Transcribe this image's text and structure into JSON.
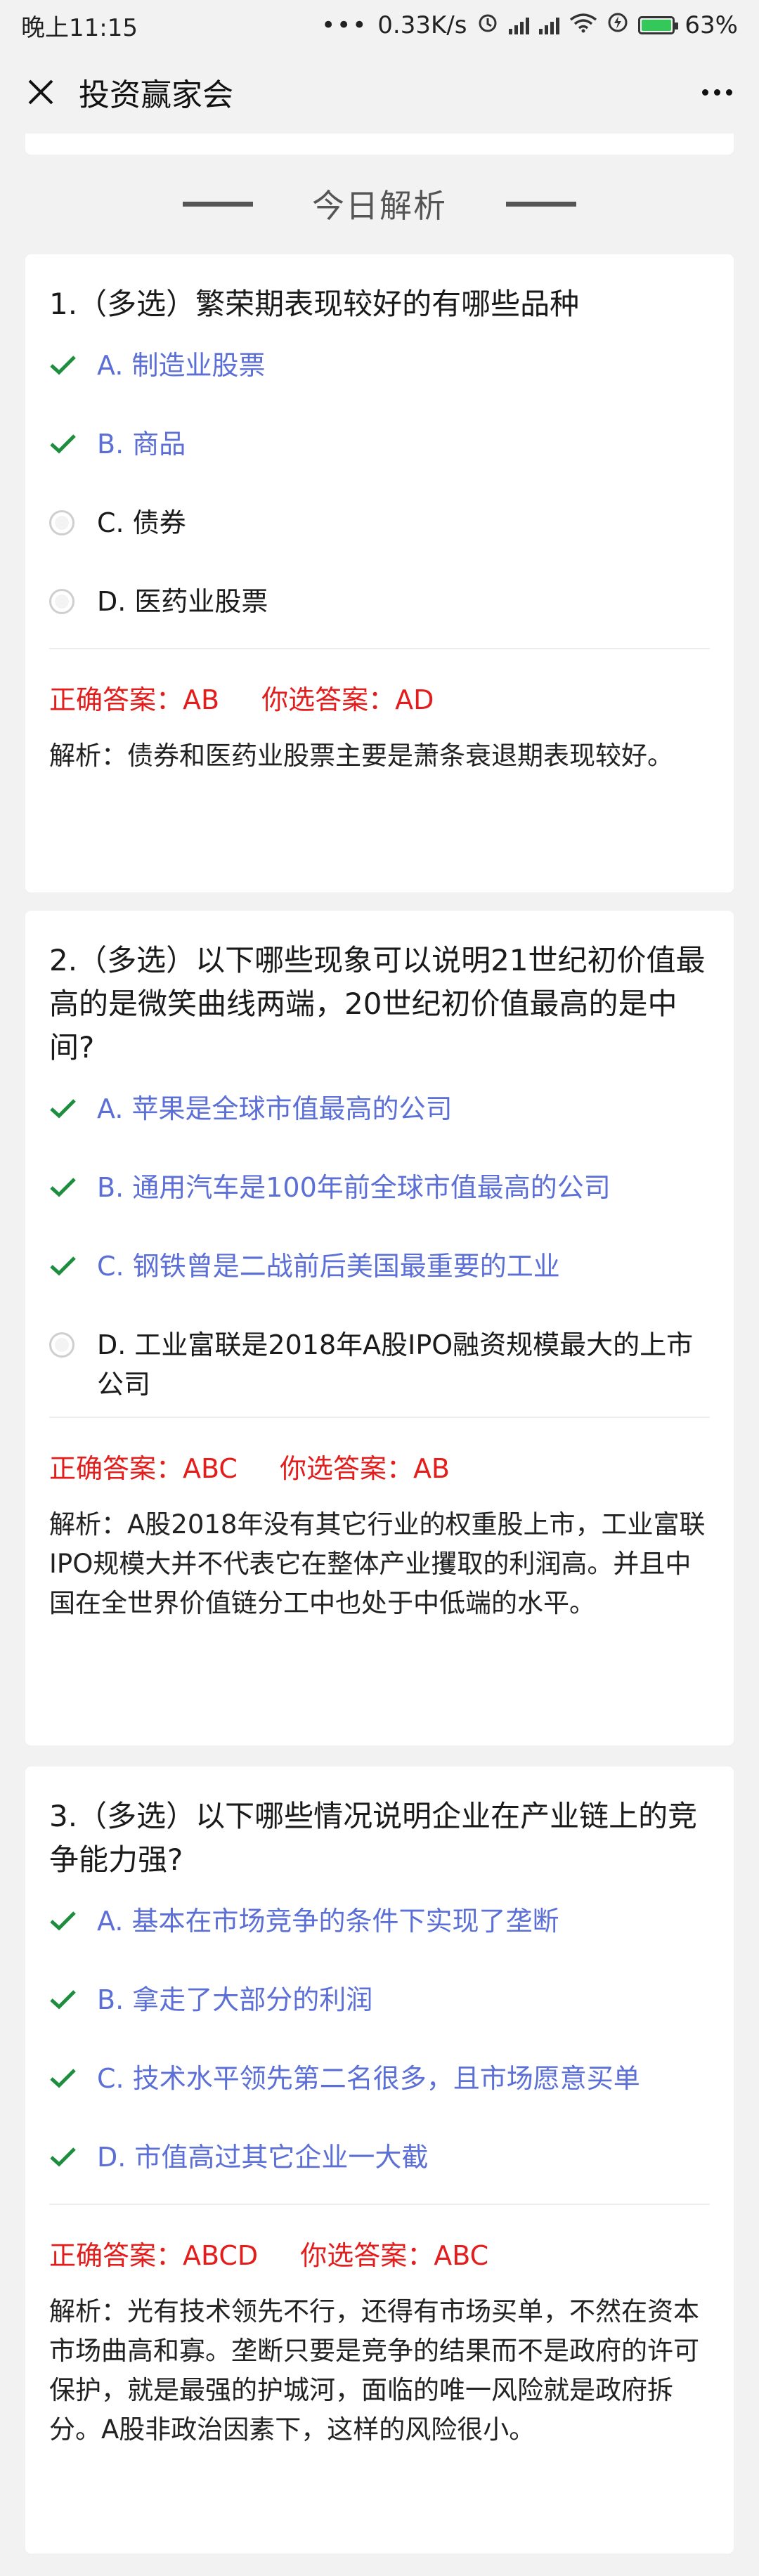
{
  "status_bar": {
    "time": "晚上11:15",
    "network": "0.33K/s",
    "battery": "63%"
  },
  "nav": {
    "title": "投资赢家会"
  },
  "section": {
    "title": "今日解析"
  },
  "colors": {
    "correct_text": "#5b6fd6",
    "check": "#1e8e3e",
    "answer_red": "#e31c1c"
  },
  "questions": [
    {
      "title": "1.（多选）繁荣期表现较好的有哪些品种",
      "options": [
        {
          "text": "A. 制造业股票",
          "correct": true
        },
        {
          "text": "B. 商品",
          "correct": true
        },
        {
          "text": "C. 债券",
          "correct": false
        },
        {
          "text": "D. 医药业股票",
          "correct": false
        }
      ],
      "correct_answer": "正确答案：AB",
      "your_answer": "你选答案：AD",
      "analysis": "解析：债券和医药业股票主要是萧条衰退期表现较好。"
    },
    {
      "title": "2.（多选）以下哪些现象可以说明21世纪初价值最高的是微笑曲线两端，20世纪初价值最高的是中间?",
      "options": [
        {
          "text": "A. 苹果是全球市值最高的公司",
          "correct": true
        },
        {
          "text": "B. 通用汽车是100年前全球市值最高的公司",
          "correct": true
        },
        {
          "text": "C. 钢铁曾是二战前后美国最重要的工业",
          "correct": true
        },
        {
          "text": "D. 工业富联是2018年A股IPO融资规模最大的上市公司",
          "correct": false
        }
      ],
      "correct_answer": "正确答案：ABC",
      "your_answer": "你选答案：AB",
      "analysis": "解析：A股2018年没有其它行业的权重股上市，工业富联IPO规模大并不代表它在整体产业攫取的利润高。并且中国在全世界价值链分工中也处于中低端的水平。"
    },
    {
      "title": "3.（多选）以下哪些情况说明企业在产业链上的竞争能力强?",
      "options": [
        {
          "text": "A. 基本在市场竞争的条件下实现了垄断",
          "correct": true
        },
        {
          "text": "B. 拿走了大部分的利润",
          "correct": true
        },
        {
          "text": "C. 技术水平领先第二名很多，且市场愿意买单",
          "correct": true
        },
        {
          "text": "D. 市值高过其它企业一大截",
          "correct": true
        }
      ],
      "correct_answer": "正确答案：ABCD",
      "your_answer": "你选答案：ABC",
      "analysis": "解析：光有技术领先不行，还得有市场买单，不然在资本市场曲高和寡。垄断只要是竞争的结果而不是政府的许可保护，就是最强的护城河，面临的唯一风险就是政府拆分。A股非政治因素下，这样的风险很小。"
    }
  ]
}
